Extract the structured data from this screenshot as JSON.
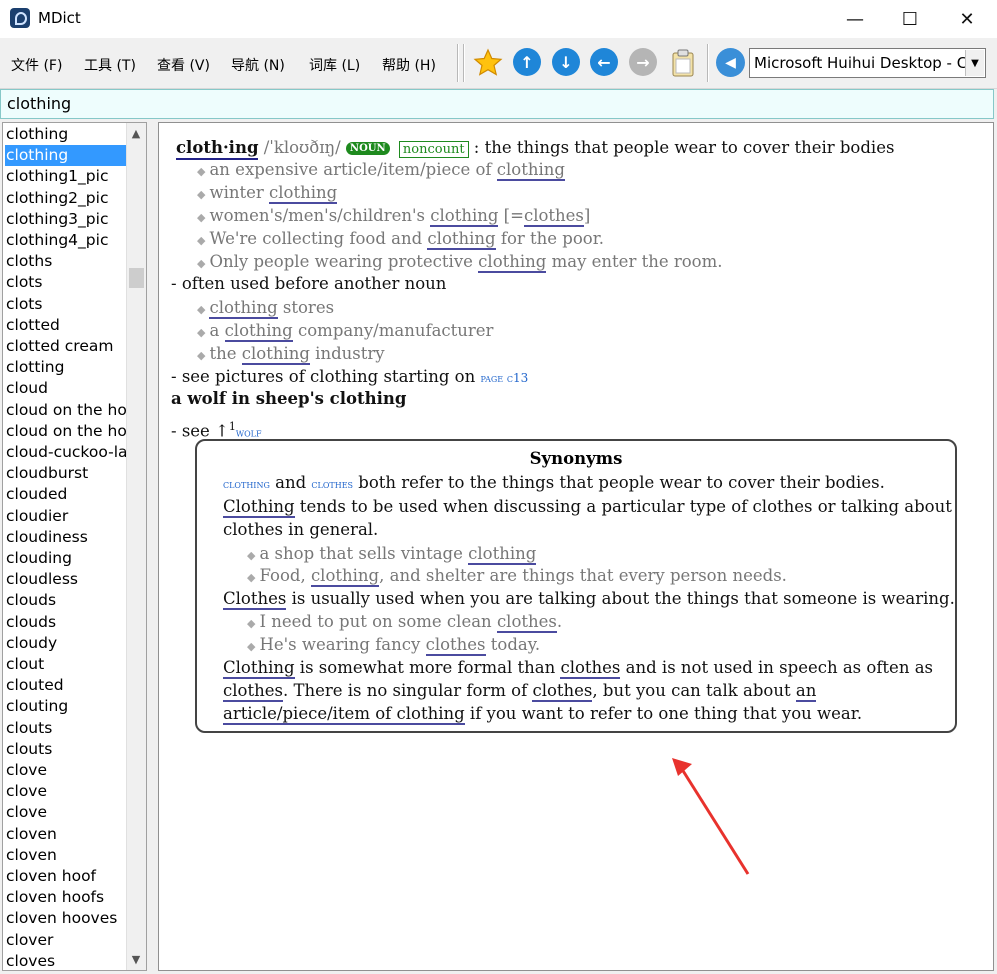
{
  "window": {
    "title": "MDict",
    "minimize": "—",
    "maximize": "☐",
    "close": "✕"
  },
  "menu": [
    "文件 (F)",
    "工具 (T)",
    "查看 (V)",
    "导航 (N)",
    "词库 (L)",
    "帮助 (H)"
  ],
  "toolbar": {
    "icons": [
      "star-icon",
      "arrow-up-icon",
      "arrow-down-icon",
      "arrow-left-icon",
      "arrow-right-icon",
      "clipboard-icon",
      "speaker-icon"
    ],
    "voice_select": "Microsoft Huihui Desktop - C"
  },
  "search": {
    "value": "clothing"
  },
  "word_list": [
    "clothing",
    "clothing",
    "clothing1_pic",
    "clothing2_pic",
    "clothing3_pic",
    "clothing4_pic",
    "cloths",
    "clots",
    "clots",
    "clotted",
    "clotted cream",
    "clotting",
    "cloud",
    "cloud on the ho",
    "cloud on the ho",
    "cloud-cuckoo-la",
    "cloudburst",
    "clouded",
    "cloudier",
    "cloudiness",
    "clouding",
    "cloudless",
    "clouds",
    "clouds",
    "cloudy",
    "clout",
    "clouted",
    "clouting",
    "clouts",
    "clouts",
    "clove",
    "clove",
    "clove",
    "cloven",
    "cloven",
    "cloven hoof",
    "cloven hoofs",
    "cloven hooves",
    "clover",
    "cloves"
  ],
  "selected_index": 1,
  "entry": {
    "headword": "cloth·ing",
    "pron": "/ˈkloʊðɪŋ/",
    "pos": "NOUN",
    "label": "noncount",
    "definition": ": the things that people wear to cover their bodies",
    "examples": [
      [
        "an expensive article/item/piece of ",
        "clothing",
        ""
      ],
      [
        "winter ",
        "clothing",
        ""
      ],
      [
        "women's/men's/children's ",
        "clothing",
        " [=",
        "clothes",
        "]"
      ],
      [
        "We're collecting food and ",
        "clothing",
        " for the poor."
      ],
      [
        "Only people wearing protective ",
        "clothing",
        " may enter the room."
      ]
    ],
    "note1": "- often used before another noun",
    "examples2": [
      [
        "",
        "clothing",
        " stores"
      ],
      [
        "a ",
        "clothing",
        " company/manufacturer"
      ],
      [
        "the ",
        "clothing",
        " industry"
      ]
    ],
    "see_pictures": "- see pictures of clothing starting on ",
    "page_ref": "page c13",
    "idiom": "a wolf in sheep's clothing",
    "see": "- see ",
    "see_arrow": "↑",
    "see_sup": "1",
    "see_ref": "wolf"
  },
  "synonyms": {
    "title": "Synonyms",
    "l1": [
      "clothing",
      " and ",
      "clothes",
      " both refer to the things that people wear to cover their bodies."
    ],
    "l2": [
      "Clothing",
      " tends to be used when discussing a particular type of clothes or talking about"
    ],
    "l3": "clothes in general.",
    "ex1": [
      "a shop that sells vintage ",
      "clothing"
    ],
    "ex2": [
      "Food, ",
      "clothing",
      ", and shelter are things that every person needs."
    ],
    "l4": [
      "Clothes",
      " is usually used when you are talking about the things that someone is wearing."
    ],
    "ex3": [
      "I need to put on some clean ",
      "clothes",
      "."
    ],
    "ex4": [
      "He's wearing fancy ",
      "clothes",
      " today."
    ],
    "l5": [
      "Clothing",
      " is somewhat more formal than ",
      "clothes",
      " and is not used in speech as often as"
    ],
    "l6": [
      "clothes",
      ". There is no singular form of ",
      "clothes",
      ", but you can talk about ",
      "an"
    ],
    "l7": [
      "article/piece/item of clothing",
      " if you want to refer to one thing that you wear."
    ]
  },
  "colors": {
    "selection": "#3399ff",
    "link": "#2266cc",
    "badge": "#1e8a1e",
    "annotation_arrow": "#e8322d"
  }
}
